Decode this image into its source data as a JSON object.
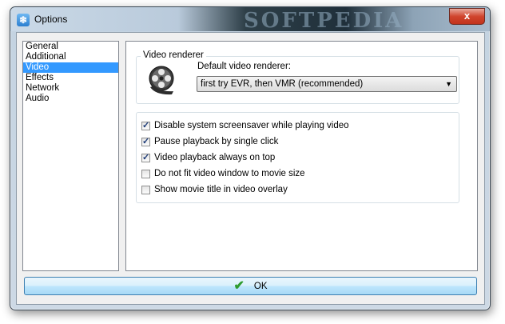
{
  "window": {
    "title": "Options",
    "watermark": "SOFTPEDIA",
    "close_glyph": "x",
    "app_icon": "snowflake-icon"
  },
  "nav": {
    "items": [
      {
        "label": "General",
        "selected": false
      },
      {
        "label": "Additional",
        "selected": false
      },
      {
        "label": "Video",
        "selected": true
      },
      {
        "label": "Effects",
        "selected": false
      },
      {
        "label": "Network",
        "selected": false
      },
      {
        "label": "Audio",
        "selected": false
      }
    ]
  },
  "renderer": {
    "group_label": "Video renderer",
    "dropdown_label": "Default video renderer:",
    "selected_value": "first try EVR, then VMR (recommended)",
    "icon": "film-reel-icon"
  },
  "options": [
    {
      "label": "Disable system screensaver while playing video",
      "checked": true
    },
    {
      "label": "Pause playback by single click",
      "checked": true
    },
    {
      "label": "Video playback always on top",
      "checked": true
    },
    {
      "label": "Do not fit video window to movie size",
      "checked": false
    },
    {
      "label": "Show movie title in video overlay",
      "checked": false
    }
  ],
  "ok_button": {
    "label": "OK",
    "icon": "checkmark-icon"
  },
  "colors": {
    "selection": "#3399ff",
    "ok_check": "#2e9b2e",
    "close": "#c2331c"
  }
}
